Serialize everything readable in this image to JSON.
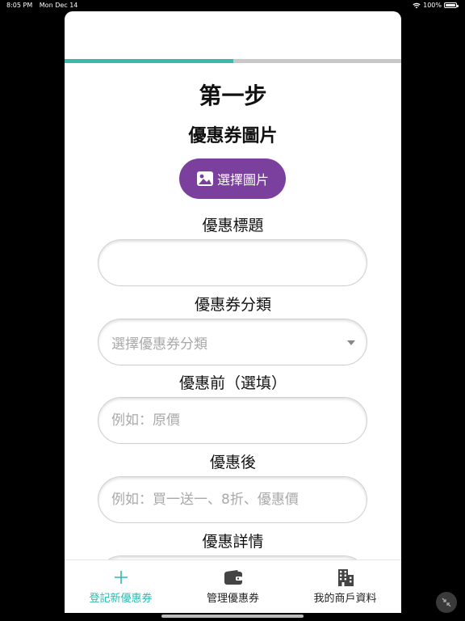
{
  "status": {
    "time": "8:05 PM",
    "date": "Mon Dec 14",
    "battery": "100%",
    "battery_level": 1.0
  },
  "progress": {
    "fraction": 0.5
  },
  "page": {
    "step_title": "第一步",
    "section_title": "優惠券圖片",
    "choose_image_label": "選擇圖片"
  },
  "form": {
    "title_label": "優惠標題",
    "title_value": "",
    "category_label": "優惠券分類",
    "category_placeholder": "選擇優惠券分類",
    "before_label": "優惠前（選填）",
    "before_placeholder": "例如：原價",
    "after_label": "優惠後",
    "after_placeholder": "例如：買一送一、8折、優惠價",
    "details_label": "優惠詳情"
  },
  "tabs": [
    {
      "label": "登記新優惠券",
      "icon": "plus-icon",
      "active": true
    },
    {
      "label": "管理優惠券",
      "icon": "wallet-icon",
      "active": false
    },
    {
      "label": "我的商戶資料",
      "icon": "building-icon",
      "active": false
    }
  ],
  "colors": {
    "accent": "#3bb7ad",
    "button": "#7b3f9e",
    "tab_active": "#2db9b0"
  }
}
